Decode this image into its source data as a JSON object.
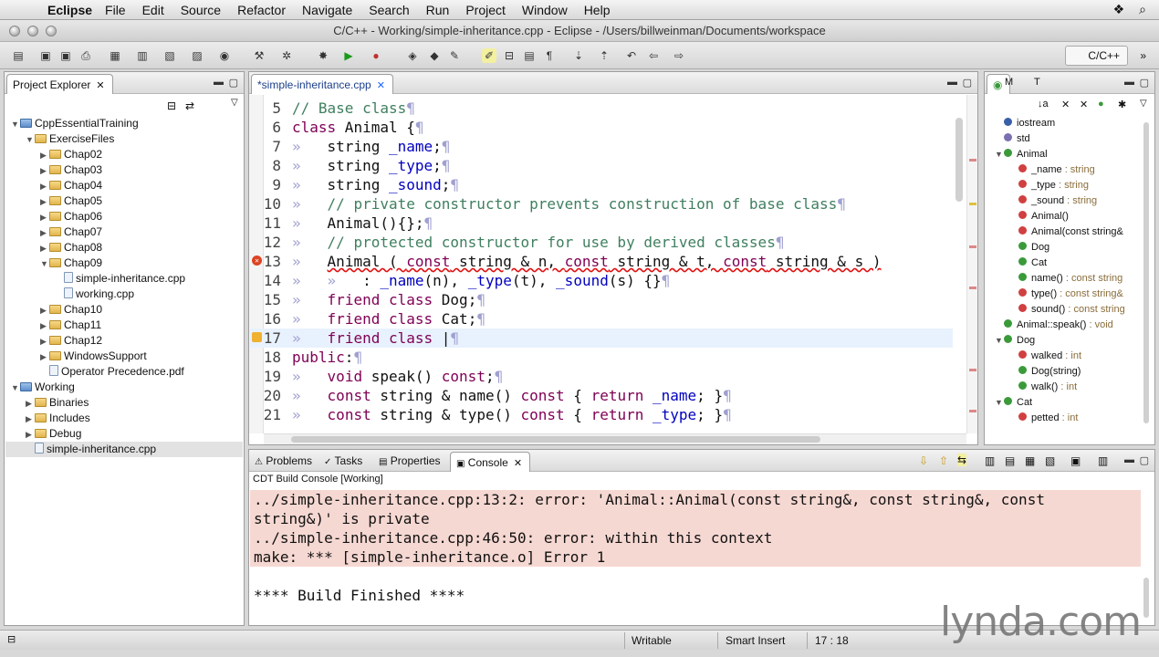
{
  "menubar": {
    "app": "Eclipse",
    "items": [
      "File",
      "Edit",
      "Source",
      "Refactor",
      "Navigate",
      "Search",
      "Run",
      "Project",
      "Window",
      "Help"
    ]
  },
  "window": {
    "title": "C/C++ - Working/simple-inheritance.cpp - Eclipse - /Users/billweinman/Documents/workspace"
  },
  "perspective": {
    "label": "C/C++"
  },
  "project_explorer": {
    "title": "Project Explorer",
    "tree": [
      {
        "label": "CppEssentialTraining",
        "level": 0,
        "kind": "proj",
        "open": true
      },
      {
        "label": "ExerciseFiles",
        "level": 1,
        "kind": "folder",
        "open": true
      },
      {
        "label": "Chap02",
        "level": 2,
        "kind": "folder",
        "open": false
      },
      {
        "label": "Chap03",
        "level": 2,
        "kind": "folder",
        "open": false
      },
      {
        "label": "Chap04",
        "level": 2,
        "kind": "folder",
        "open": false
      },
      {
        "label": "Chap05",
        "level": 2,
        "kind": "folder",
        "open": false
      },
      {
        "label": "Chap06",
        "level": 2,
        "kind": "folder",
        "open": false
      },
      {
        "label": "Chap07",
        "level": 2,
        "kind": "folder",
        "open": false
      },
      {
        "label": "Chap08",
        "level": 2,
        "kind": "folder",
        "open": false
      },
      {
        "label": "Chap09",
        "level": 2,
        "kind": "folder",
        "open": true
      },
      {
        "label": "simple-inheritance.cpp",
        "level": 3,
        "kind": "file"
      },
      {
        "label": "working.cpp",
        "level": 3,
        "kind": "file"
      },
      {
        "label": "Chap10",
        "level": 2,
        "kind": "folder",
        "open": false
      },
      {
        "label": "Chap11",
        "level": 2,
        "kind": "folder",
        "open": false
      },
      {
        "label": "Chap12",
        "level": 2,
        "kind": "folder",
        "open": false
      },
      {
        "label": "WindowsSupport",
        "level": 2,
        "kind": "folder",
        "open": false
      },
      {
        "label": "Operator Precedence.pdf",
        "level": 2,
        "kind": "file"
      },
      {
        "label": "Working",
        "level": 0,
        "kind": "proj",
        "open": true
      },
      {
        "label": "Binaries",
        "level": 1,
        "kind": "folder",
        "open": false
      },
      {
        "label": "Includes",
        "level": 1,
        "kind": "folder",
        "open": false
      },
      {
        "label": "Debug",
        "level": 1,
        "kind": "folder",
        "open": false
      },
      {
        "label": "simple-inheritance.cpp",
        "level": 1,
        "kind": "file",
        "selected": true
      }
    ]
  },
  "editor": {
    "tab": "*simple-inheritance.cpp",
    "lines": [
      {
        "n": "5",
        "html": "<span class='cm'>// Base class</span><span class='ws'>¶</span>"
      },
      {
        "n": "6",
        "html": "<span class='kw'>class</span> Animal {<span class='ws'>¶</span>"
      },
      {
        "n": "7",
        "html": "<span class='ws'>»</span>   string <span class='id'>_name</span>;<span class='ws'>¶</span>"
      },
      {
        "n": "8",
        "html": "<span class='ws'>»</span>   string <span class='id'>_type</span>;<span class='ws'>¶</span>"
      },
      {
        "n": "9",
        "html": "<span class='ws'>»</span>   string <span class='id'>_sound</span>;<span class='ws'>¶</span>"
      },
      {
        "n": "10",
        "html": "<span class='ws'>»</span>   <span class='cm'>// private constructor prevents construction of base class</span><span class='ws'>¶</span>"
      },
      {
        "n": "11",
        "html": "<span class='ws'>»</span>   Animal(){};<span class='ws'>¶</span>"
      },
      {
        "n": "12",
        "html": "<span class='ws'>»</span>   <span class='cm'>// protected constructor for use by derived classes</span><span class='ws'>¶</span>"
      },
      {
        "n": "13",
        "html": "<span class='ws'>»</span>   <span class='err'>Animal ( <span class='kw'>const</span> string &amp; n, <span class='kw'>const</span> string &amp; t, <span class='kw'>const</span> string &amp; s )</span>",
        "marker": "err"
      },
      {
        "n": "14",
        "html": "<span class='ws'>»</span>   <span class='ws'>»</span>   : <span class='id'>_name</span>(n), <span class='id'>_type</span>(t), <span class='id'>_sound</span>(s) {}<span class='ws'>¶</span>"
      },
      {
        "n": "15",
        "html": "<span class='ws'>»</span>   <span class='kw'>friend</span> <span class='kw'>class</span> Dog;<span class='ws'>¶</span>"
      },
      {
        "n": "16",
        "html": "<span class='ws'>»</span>   <span class='kw'>friend</span> <span class='kw'>class</span> Cat;<span class='ws'>¶</span>"
      },
      {
        "n": "17",
        "html": "<span class='ws'>»</span>   <span class='kw'>friend</span> <span class='kw'>class</span> |<span class='ws'>¶</span>",
        "marker": "warn",
        "current": true
      },
      {
        "n": "18",
        "html": "<span class='kw'>public</span>:<span class='ws'>¶</span>"
      },
      {
        "n": "19",
        "html": "<span class='ws'>»</span>   <span class='kw'>void</span> speak() <span class='kw'>const</span>;<span class='ws'>¶</span>"
      },
      {
        "n": "20",
        "html": "<span class='ws'>»</span>   <span class='kw'>const</span> string &amp; name() <span class='kw'>const</span> { <span class='kw'>return</span> <span class='id'>_name</span>; }<span class='ws'>¶</span>"
      },
      {
        "n": "21",
        "html": "<span class='ws'>»</span>   <span class='kw'>const</span> string &amp; type() <span class='kw'>const</span> { <span class='kw'>return</span> <span class='id'>_type</span>; }<span class='ws'>¶</span>"
      }
    ]
  },
  "outline": {
    "tabs": [
      "M",
      "T"
    ],
    "items": [
      {
        "label": "iostream",
        "type": "",
        "level": 0,
        "color": "#3a5fa8"
      },
      {
        "label": "std",
        "type": "",
        "level": 0,
        "color": "#7a6fb0"
      },
      {
        "label": "Animal",
        "type": "",
        "level": 0,
        "color": "#3a9a3a",
        "open": true
      },
      {
        "label": "_name",
        "type": " : string",
        "level": 1,
        "color": "#d04040"
      },
      {
        "label": "_type",
        "type": " : string",
        "level": 1,
        "color": "#d04040"
      },
      {
        "label": "_sound",
        "type": " : string",
        "level": 1,
        "color": "#d04040"
      },
      {
        "label": "Animal()",
        "type": "",
        "level": 1,
        "color": "#d04040"
      },
      {
        "label": "Animal(const string&",
        "type": "",
        "level": 1,
        "color": "#d04040"
      },
      {
        "label": "Dog",
        "type": "",
        "level": 1,
        "color": "#3a9a3a"
      },
      {
        "label": "Cat",
        "type": "",
        "level": 1,
        "color": "#3a9a3a"
      },
      {
        "label": "name()",
        "type": " : const string",
        "level": 1,
        "color": "#3a9a3a"
      },
      {
        "label": "type()",
        "type": " : const string&",
        "level": 1,
        "color": "#d04040"
      },
      {
        "label": "sound()",
        "type": " : const string",
        "level": 1,
        "color": "#d04040"
      },
      {
        "label": "Animal::speak()",
        "type": " : void",
        "level": 0,
        "color": "#3a9a3a"
      },
      {
        "label": "Dog",
        "type": "",
        "level": 0,
        "color": "#3a9a3a",
        "open": true
      },
      {
        "label": "walked",
        "type": " : int",
        "level": 1,
        "color": "#d04040"
      },
      {
        "label": "Dog(string)",
        "type": "",
        "level": 1,
        "color": "#3a9a3a"
      },
      {
        "label": "walk()",
        "type": " : int",
        "level": 1,
        "color": "#3a9a3a"
      },
      {
        "label": "Cat",
        "type": "",
        "level": 0,
        "color": "#3a9a3a",
        "open": true
      },
      {
        "label": "petted",
        "type": " : int",
        "level": 1,
        "color": "#d04040"
      }
    ]
  },
  "bottom_tabs": {
    "problems": "Problems",
    "tasks": "Tasks",
    "properties": "Properties",
    "console": "Console"
  },
  "console": {
    "header": "CDT Build Console [Working]",
    "lines": [
      "../simple-inheritance.cpp:13:2: error: 'Animal::Animal(const string&, const string&, const",
      "string&)' is private",
      "../simple-inheritance.cpp:46:50: error: within this context",
      "make: *** [simple-inheritance.o] Error 1",
      "",
      "**** Build Finished ****"
    ]
  },
  "status": {
    "writable": "Writable",
    "insert_mode": "Smart Insert",
    "position": "17 : 18"
  },
  "watermark": "lynda.com"
}
